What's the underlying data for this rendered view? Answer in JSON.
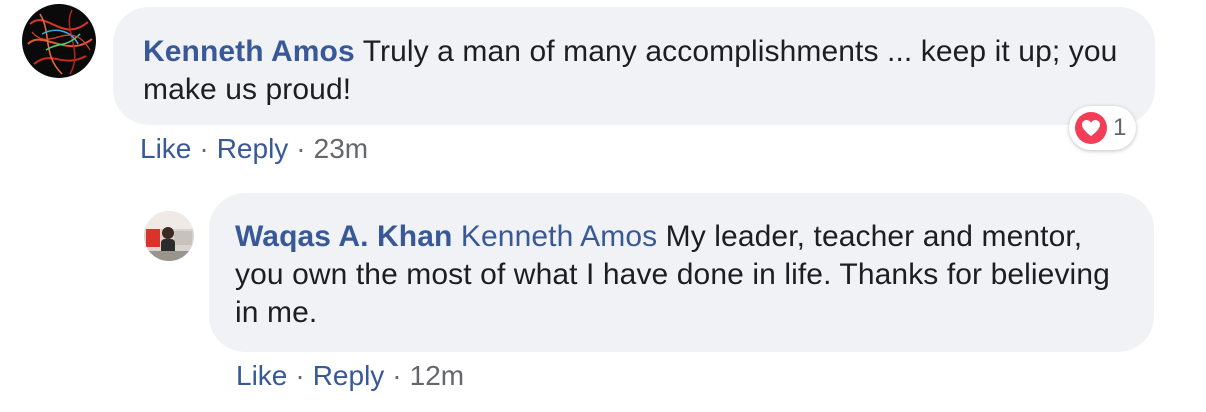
{
  "comments": [
    {
      "author": "Kenneth Amos",
      "mention": "",
      "text": "Truly a man of many accomplishments ... keep it up; you make us proud!",
      "actions": {
        "like": "Like",
        "reply": "Reply",
        "time": "23m",
        "separator": "·"
      },
      "reaction": {
        "icon": "heart-icon",
        "count": "1",
        "color": "#f33e58"
      }
    },
    {
      "author": "Waqas A. Khan",
      "mention": "Kenneth Amos",
      "text": "My leader, teacher and mentor, you own the most of what I have done in life. Thanks for believing in me.",
      "actions": {
        "like": "Like",
        "reply": "Reply",
        "time": "12m",
        "separator": "·"
      }
    }
  ],
  "colors": {
    "link": "#385898",
    "bubble": "#f0f2f5",
    "meta": "#65676b"
  }
}
